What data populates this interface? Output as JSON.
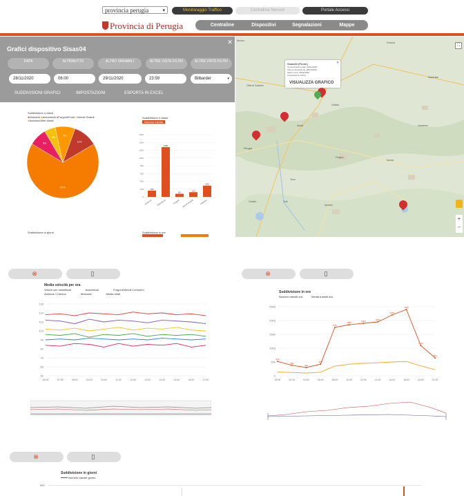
{
  "header": {
    "province_select": "provincia perugia",
    "top_pills": [
      "Monitoraggio Traffico",
      "Centralina Sensori",
      "Portale Accessi"
    ],
    "logo_text": "Provincia di Perugia",
    "nav": [
      "Centraline",
      "Dispositivi",
      "Segnalazioni",
      "Mappe"
    ]
  },
  "panel": {
    "title": "Grafici dispositivo Sisas04",
    "filters": [
      "DATA",
      "ALTRIBUTTO",
      "ALTRO VARIABILI",
      "ALTRE VISTE FILTRI",
      "ALTRE VISTE FILTRI"
    ],
    "fields": [
      "28/11/2020",
      "06:00",
      "29/11/2020",
      "23:59",
      "Bilbarder"
    ],
    "actions": [
      "SUDDIVISIONI GRAFICI",
      "IMPOSTAZIONI",
      "ESPORTA IN EXCEL"
    ],
    "pie_title": "Suddivisione n classi",
    "pie_legend": [
      "Motocicli",
      "Autoveicoli",
      "Furgoni/Fuori",
      "Veicoli Grandi",
      "Autobus/Altre classi"
    ],
    "bar_title": "Suddivisione n classi",
    "bar_legend": "Numero transiti",
    "small_labels": [
      "Suddivisione in giorni",
      "Suddivisione in ore"
    ]
  },
  "map": {
    "popup_lines": [
      "Sisas04 (Ponte)",
      "Comunicazione Dati: 28/11/2020",
      "Ultima connessione: 28/11/2020",
      "Ultimo invio: 28/11/2020",
      "Connessione: Attiva"
    ],
    "popup_link": "VISUALIZZA GRAFICO",
    "places": [
      "Città di Castello",
      "Perugia",
      "Foligno",
      "Spoleto",
      "Terni",
      "Assisi",
      "Todi",
      "Orvieto",
      "Gubbio",
      "Norcia",
      "Arezzo",
      "Macerata",
      "Cesena",
      "Camerino"
    ]
  },
  "charts": {
    "avg_speed": {
      "title": "Media velocità per ora",
      "legend": [
        "Veicoli non classificati",
        "Autoveicoli",
        "Furgoni/Veicoli Commerc.",
        "Autobus / Camion",
        "Motocicli",
        "Media totali"
      ],
      "ylabels": [
        "130",
        "120",
        "110",
        "100",
        "90",
        "80",
        "70",
        "60",
        "50"
      ],
      "xlabels": [
        "06:00",
        "07:00",
        "08:00",
        "09:00",
        "10:00",
        "11:00",
        "12:00",
        "13:00",
        "14:00",
        "15:00",
        "16:00",
        "17:00"
      ]
    },
    "hourly": {
      "title": "Suddivisione in ore",
      "legend": [
        "Numero transiti ora",
        "Media transiti ora"
      ],
      "ylabels": [
        "2500",
        "2000",
        "1500",
        "1000",
        "500",
        "0"
      ],
      "xlabels": [
        "00:00",
        "02:00",
        "04:00",
        "06:00",
        "08:00",
        "10:00",
        "12:00",
        "14:00",
        "16:00",
        "18:00",
        "20:00",
        "22:00"
      ]
    },
    "daily": {
      "title": "Suddivisione in giorni",
      "legend": "Numero transiti giorno",
      "ytick": "500"
    }
  },
  "chart_data": [
    {
      "type": "pie",
      "title": "Suddivisione n classi",
      "categories": [
        "Motocicli",
        "Autoveicoli",
        "Furgoni/Fuori",
        "Veicoli Grandi",
        "Autobus/Altre classi"
      ],
      "values": [
        11,
        67,
        8,
        5,
        9
      ]
    },
    {
      "type": "bar",
      "title": "Suddivisione n classi",
      "categories": [
        "Motocicli",
        "Autoveicoli",
        "Furgoni",
        "Veicoli Grandi",
        "Autobus"
      ],
      "values": [
        160,
        1280,
        80,
        120,
        290
      ],
      "ylim": [
        0,
        1600
      ]
    },
    {
      "type": "line",
      "title": "Media velocità per ora",
      "x": [
        "06:00",
        "07:00",
        "08:00",
        "09:00",
        "10:00",
        "11:00",
        "12:00",
        "13:00",
        "14:00",
        "15:00",
        "16:00",
        "17:00"
      ],
      "series": [
        {
          "name": "Veicoli non classificati",
          "values": [
            112,
            111,
            108,
            113,
            110,
            112,
            111,
            109,
            112,
            111,
            110,
            108
          ]
        },
        {
          "name": "Autoveicoli",
          "values": [
            118,
            119,
            117,
            120,
            119,
            118,
            121,
            119,
            120,
            118,
            119,
            117
          ]
        },
        {
          "name": "Furgoni/Veicoli Commerc.",
          "values": [
            102,
            101,
            103,
            100,
            102,
            104,
            101,
            103,
            102,
            104,
            101,
            100
          ]
        },
        {
          "name": "Autobus / Camion",
          "values": [
            96,
            95,
            97,
            93,
            96,
            95,
            97,
            94,
            96,
            95,
            96,
            94
          ]
        },
        {
          "name": "Motocicli",
          "values": [
            84,
            83,
            86,
            85,
            82,
            86,
            83,
            85,
            84,
            86,
            82,
            84
          ]
        },
        {
          "name": "Media totali",
          "values": [
            90,
            91,
            90,
            92,
            91,
            90,
            91,
            90,
            92,
            91,
            90,
            91
          ]
        }
      ],
      "ylim": [
        50,
        130
      ]
    },
    {
      "type": "line",
      "title": "Suddivisione in ore",
      "x": [
        "00:00",
        "02:00",
        "04:00",
        "06:00",
        "08:00",
        "10:00",
        "12:00",
        "14:00",
        "16:00",
        "18:00",
        "20:00",
        "22:00"
      ],
      "series": [
        {
          "name": "Numero transiti ora",
          "values": [
            520,
            380,
            300,
            420,
            1750,
            1850,
            1900,
            1950,
            2200,
            2400,
            1100,
            650
          ]
        },
        {
          "name": "Media transiti ora",
          "values": [
            140,
            120,
            100,
            130,
            350,
            420,
            450,
            470,
            500,
            520,
            360,
            220
          ]
        }
      ],
      "ylim": [
        0,
        2500
      ]
    }
  ]
}
